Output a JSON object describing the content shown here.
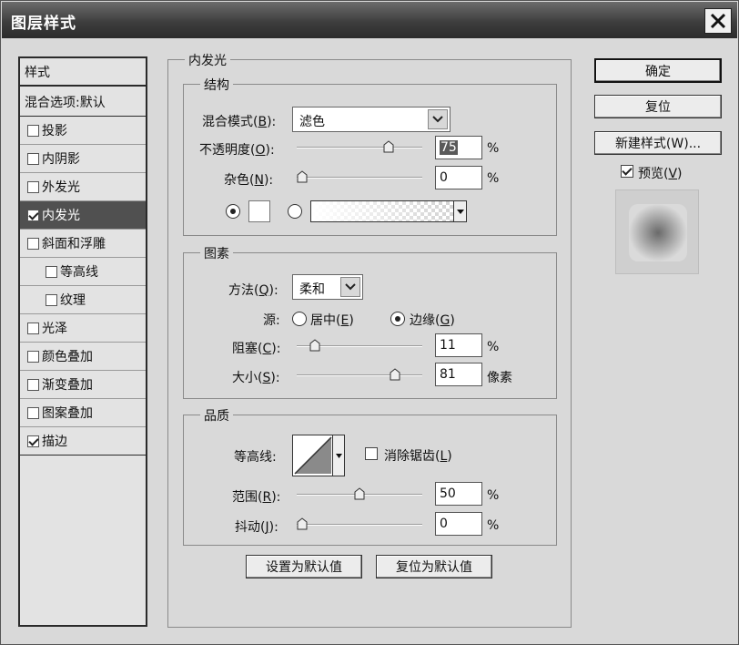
{
  "window": {
    "title": "图层样式"
  },
  "style_list": {
    "header": "样式",
    "blend_options": "混合选项:默认",
    "items": [
      {
        "label": "投影",
        "checked": false,
        "selected": false,
        "indent": false
      },
      {
        "label": "内阴影",
        "checked": false,
        "selected": false,
        "indent": false
      },
      {
        "label": "外发光",
        "checked": false,
        "selected": false,
        "indent": false
      },
      {
        "label": "内发光",
        "checked": true,
        "selected": true,
        "indent": false
      },
      {
        "label": "斜面和浮雕",
        "checked": false,
        "selected": false,
        "indent": false
      },
      {
        "label": "等高线",
        "checked": false,
        "selected": false,
        "indent": true
      },
      {
        "label": "纹理",
        "checked": false,
        "selected": false,
        "indent": true
      },
      {
        "label": "光泽",
        "checked": false,
        "selected": false,
        "indent": false
      },
      {
        "label": "颜色叠加",
        "checked": false,
        "selected": false,
        "indent": false
      },
      {
        "label": "渐变叠加",
        "checked": false,
        "selected": false,
        "indent": false
      },
      {
        "label": "图案叠加",
        "checked": false,
        "selected": false,
        "indent": false
      },
      {
        "label": "描边",
        "checked": true,
        "selected": false,
        "indent": false
      }
    ]
  },
  "panel": {
    "title": "内发光",
    "structure": {
      "legend": "结构",
      "blend_mode": {
        "label": "混合模式",
        "key": "B",
        "value": "滤色"
      },
      "opacity": {
        "label": "不透明度",
        "key": "O",
        "value": "75",
        "unit": "%",
        "level": 75
      },
      "noise": {
        "label": "杂色",
        "key": "N",
        "value": "0",
        "unit": "%",
        "level": 0
      }
    },
    "elements": {
      "legend": "图素",
      "technique": {
        "label": "方法",
        "key": "Q",
        "value": "柔和"
      },
      "source": {
        "label": "源",
        "center": "居中",
        "center_key": "E",
        "edge": "边缘",
        "edge_key": "G",
        "selected": "edge"
      },
      "choke": {
        "label": "阻塞",
        "key": "C",
        "value": "11",
        "unit": "%",
        "level": 11
      },
      "size": {
        "label": "大小",
        "key": "S",
        "value": "81",
        "unit": "像素",
        "level": 81
      }
    },
    "quality": {
      "legend": "品质",
      "contour": {
        "label": "等高线:"
      },
      "anti_alias": {
        "label": "消除锯齿",
        "key": "L",
        "checked": false
      },
      "range": {
        "label": "范围",
        "key": "R",
        "value": "50",
        "unit": "%",
        "level": 50
      },
      "jitter": {
        "label": "抖动",
        "key": "J",
        "value": "0",
        "unit": "%",
        "level": 0
      }
    },
    "make_default": "设置为默认值",
    "reset_default": "复位为默认值"
  },
  "buttons": {
    "ok": "确定",
    "reset": "复位",
    "new_style": "新建样式(W)...",
    "preview": {
      "label": "预览",
      "key": "V",
      "checked": true
    }
  }
}
